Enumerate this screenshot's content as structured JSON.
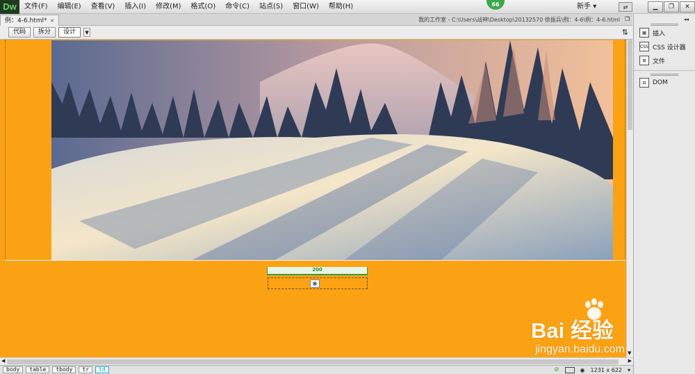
{
  "app": {
    "logo": "Dw",
    "menus": [
      "文件(F)",
      "编辑(E)",
      "查看(V)",
      "插入(I)",
      "修改(M)",
      "格式(O)",
      "命令(C)",
      "站点(S)",
      "窗口(W)",
      "帮助(H)"
    ],
    "badge": "66",
    "workspace": "新手"
  },
  "document": {
    "tab_label": "例：4-6.html*",
    "path": "我的工作室 - C:\\Users\\战神\\Desktop\\20132570 徐振兵\\例：4-6\\例：4-6.html"
  },
  "toolbar": {
    "code_label": "代码",
    "split_label": "拆分",
    "design_label": "设计"
  },
  "canvas": {
    "width_value": "200",
    "background_color": "#fba214"
  },
  "statusbar": {
    "tags": [
      "body",
      "table",
      "tbody",
      "tr",
      "td"
    ],
    "dimensions": "1231 x 622"
  },
  "panel": {
    "items": [
      {
        "label": "插入",
        "icon": "insert-icon"
      },
      {
        "label": "CSS 设计器",
        "icon": "css-designer-icon"
      },
      {
        "label": "文件",
        "icon": "files-icon"
      },
      {
        "label": "DOM",
        "icon": "dom-icon"
      }
    ]
  },
  "watermark": {
    "logo": "Bai 经验",
    "url": "jingyan.baidu.com"
  }
}
